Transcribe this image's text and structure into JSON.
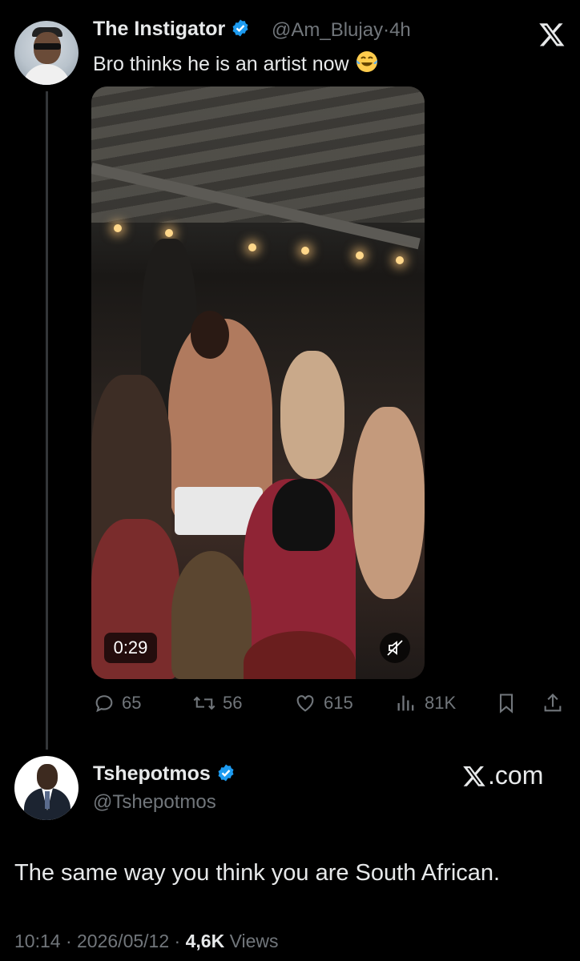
{
  "quoted": {
    "author_name": "The Instigator",
    "handle": "@Am_Blujay",
    "time": "4h",
    "separator": "·",
    "text": "Bro thinks he is an artist now",
    "emoji": "😂",
    "video_duration": "0:29",
    "stats": {
      "replies": "65",
      "reposts": "56",
      "likes": "615",
      "views": "81K"
    }
  },
  "main": {
    "author_name": "Tshepotmos",
    "handle": "@Tshepotmos",
    "source_label": ".com",
    "text": "The same way you think you are South African.",
    "time": "10:14",
    "date": "2026/05/12",
    "sep1": "·",
    "sep2": "·",
    "views_count": "4,6K",
    "views_label": "Views"
  },
  "colors": {
    "background": "#000000",
    "primary_text": "#e7e9ea",
    "secondary_text": "#71767b",
    "verified_blue": "#1d9bf0",
    "thread_line": "#333639"
  },
  "icons": [
    "x-logo-icon",
    "verified-badge-icon",
    "reply-icon",
    "repost-icon",
    "like-icon",
    "views-icon",
    "bookmark-icon",
    "share-icon",
    "mute-icon"
  ]
}
